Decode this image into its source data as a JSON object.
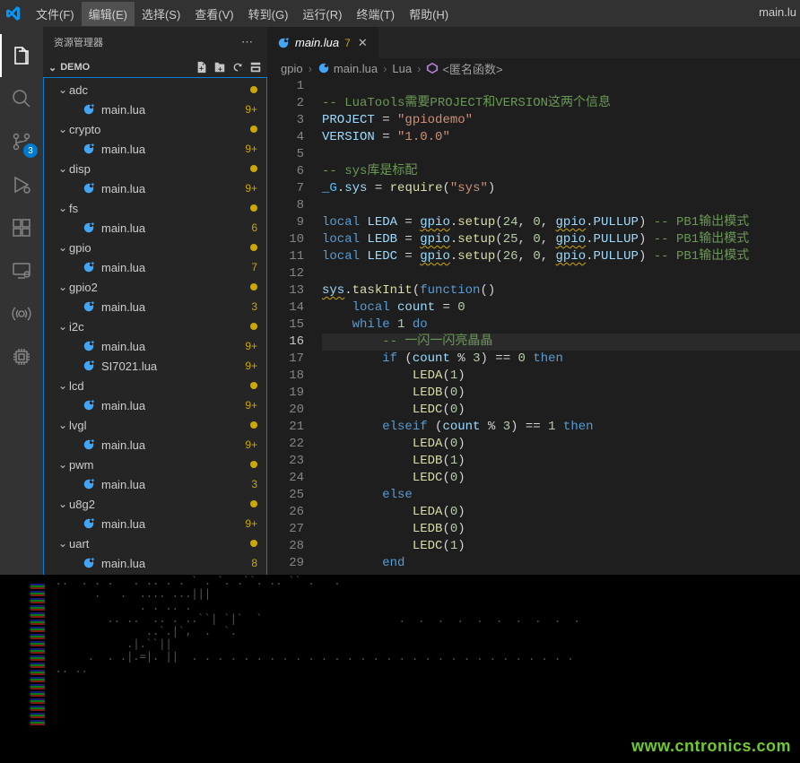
{
  "menubar": {
    "items": [
      "文件(F)",
      "编辑(E)",
      "选择(S)",
      "查看(V)",
      "转到(G)",
      "运行(R)",
      "终端(T)",
      "帮助(H)"
    ],
    "activeIndex": 1,
    "titleRight": "main.lu"
  },
  "activitybar": {
    "items": [
      {
        "name": "explorer",
        "active": true
      },
      {
        "name": "search"
      },
      {
        "name": "source-control",
        "badge": "3"
      },
      {
        "name": "run-debug"
      },
      {
        "name": "extensions"
      },
      {
        "name": "remote"
      },
      {
        "name": "live-share"
      },
      {
        "name": "chip"
      }
    ]
  },
  "sidebar": {
    "title": "资源管理器",
    "root": "DEMO",
    "tree": [
      {
        "type": "folder",
        "label": "adc",
        "decor": "dot"
      },
      {
        "type": "file",
        "label": "main.lua",
        "decor": "9+"
      },
      {
        "type": "folder",
        "label": "crypto",
        "decor": "dot"
      },
      {
        "type": "file",
        "label": "main.lua",
        "decor": "9+"
      },
      {
        "type": "folder",
        "label": "disp",
        "decor": "dot"
      },
      {
        "type": "file",
        "label": "main.lua",
        "decor": "9+"
      },
      {
        "type": "folder",
        "label": "fs",
        "decor": "dot"
      },
      {
        "type": "file",
        "label": "main.lua",
        "decor": "6"
      },
      {
        "type": "folder",
        "label": "gpio",
        "decor": "dot"
      },
      {
        "type": "file",
        "label": "main.lua",
        "decor": "7"
      },
      {
        "type": "folder",
        "label": "gpio2",
        "decor": "dot"
      },
      {
        "type": "file",
        "label": "main.lua",
        "decor": "3"
      },
      {
        "type": "folder",
        "label": "i2c",
        "decor": "dot"
      },
      {
        "type": "file",
        "label": "main.lua",
        "decor": "9+"
      },
      {
        "type": "file",
        "label": "SI7021.lua",
        "decor": "9+"
      },
      {
        "type": "folder",
        "label": "lcd",
        "decor": "dot"
      },
      {
        "type": "file",
        "label": "main.lua",
        "decor": "9+"
      },
      {
        "type": "folder",
        "label": "lvgl",
        "decor": "dot"
      },
      {
        "type": "file",
        "label": "main.lua",
        "decor": "9+"
      },
      {
        "type": "folder",
        "label": "pwm",
        "decor": "dot"
      },
      {
        "type": "file",
        "label": "main.lua",
        "decor": "3"
      },
      {
        "type": "folder",
        "label": "u8g2",
        "decor": "dot"
      },
      {
        "type": "file",
        "label": "main.lua",
        "decor": "9+"
      },
      {
        "type": "folder",
        "label": "uart",
        "decor": "dot"
      },
      {
        "type": "file",
        "label": "main.lua",
        "decor": "8"
      }
    ]
  },
  "tab": {
    "filename": "main.lua",
    "modified": "7"
  },
  "breadcrumb": [
    "gpio",
    "main.lua",
    "Lua",
    "<匿名函数>"
  ],
  "editor": {
    "activeLine": 16,
    "lineCount": 29
  },
  "code": {
    "cmt1": "-- LuaTools需要PROJECT和VERSION这两个信息",
    "proj": "PROJECT",
    "eq": " = ",
    "projval": "\"gpiodemo\"",
    "ver": "VERSION",
    "verval": "\"1.0.0\"",
    "cmt2": "-- sys库是标配",
    "g": "_G",
    "sys": "sys",
    "req": "require",
    "sysarg": "\"sys\"",
    "local": "local ",
    "leda": "LEDA",
    "ledb": "LEDB",
    "ledc": "LEDC",
    "gpio": "gpio",
    "setup": "setup",
    "pullup": "PULLUP",
    "n24": "24",
    "n25": "25",
    "n26": "26",
    "n0": "0",
    "n1": "1",
    "n3": "3",
    "cmtPB": "-- PB1输出模式",
    "taskInit": "taskInit",
    "function": "function",
    "count": "count",
    "while": "while",
    "do": "do",
    "true": "true",
    "cmt3": "-- 一闪一闪亮晶晶",
    "if": "if",
    "then": "then",
    "elseif": "elseif",
    "else": "else",
    "end": "end"
  },
  "corruptLines": [
    "   ..  . . .   . .. . . ` . `. .``. .. `` .   .",
    "         .   .  .... ...||| ",
    "                . . .. .",
    "",
    "           .. ..  .. . ..``| `|`  `                     .  .  .  .  .  .  .  .  .  .",
    "                 ..`.|`,  .  `.",
    "              .|.``||",
    "        .  . .|.=|. ||  . . . . . . . . . . . . . . . . . . . . . . . . . . . . . .",
    "",
    "   .. ..       ",
    "",
    ""
  ],
  "watermark": "www.cntronics.com"
}
